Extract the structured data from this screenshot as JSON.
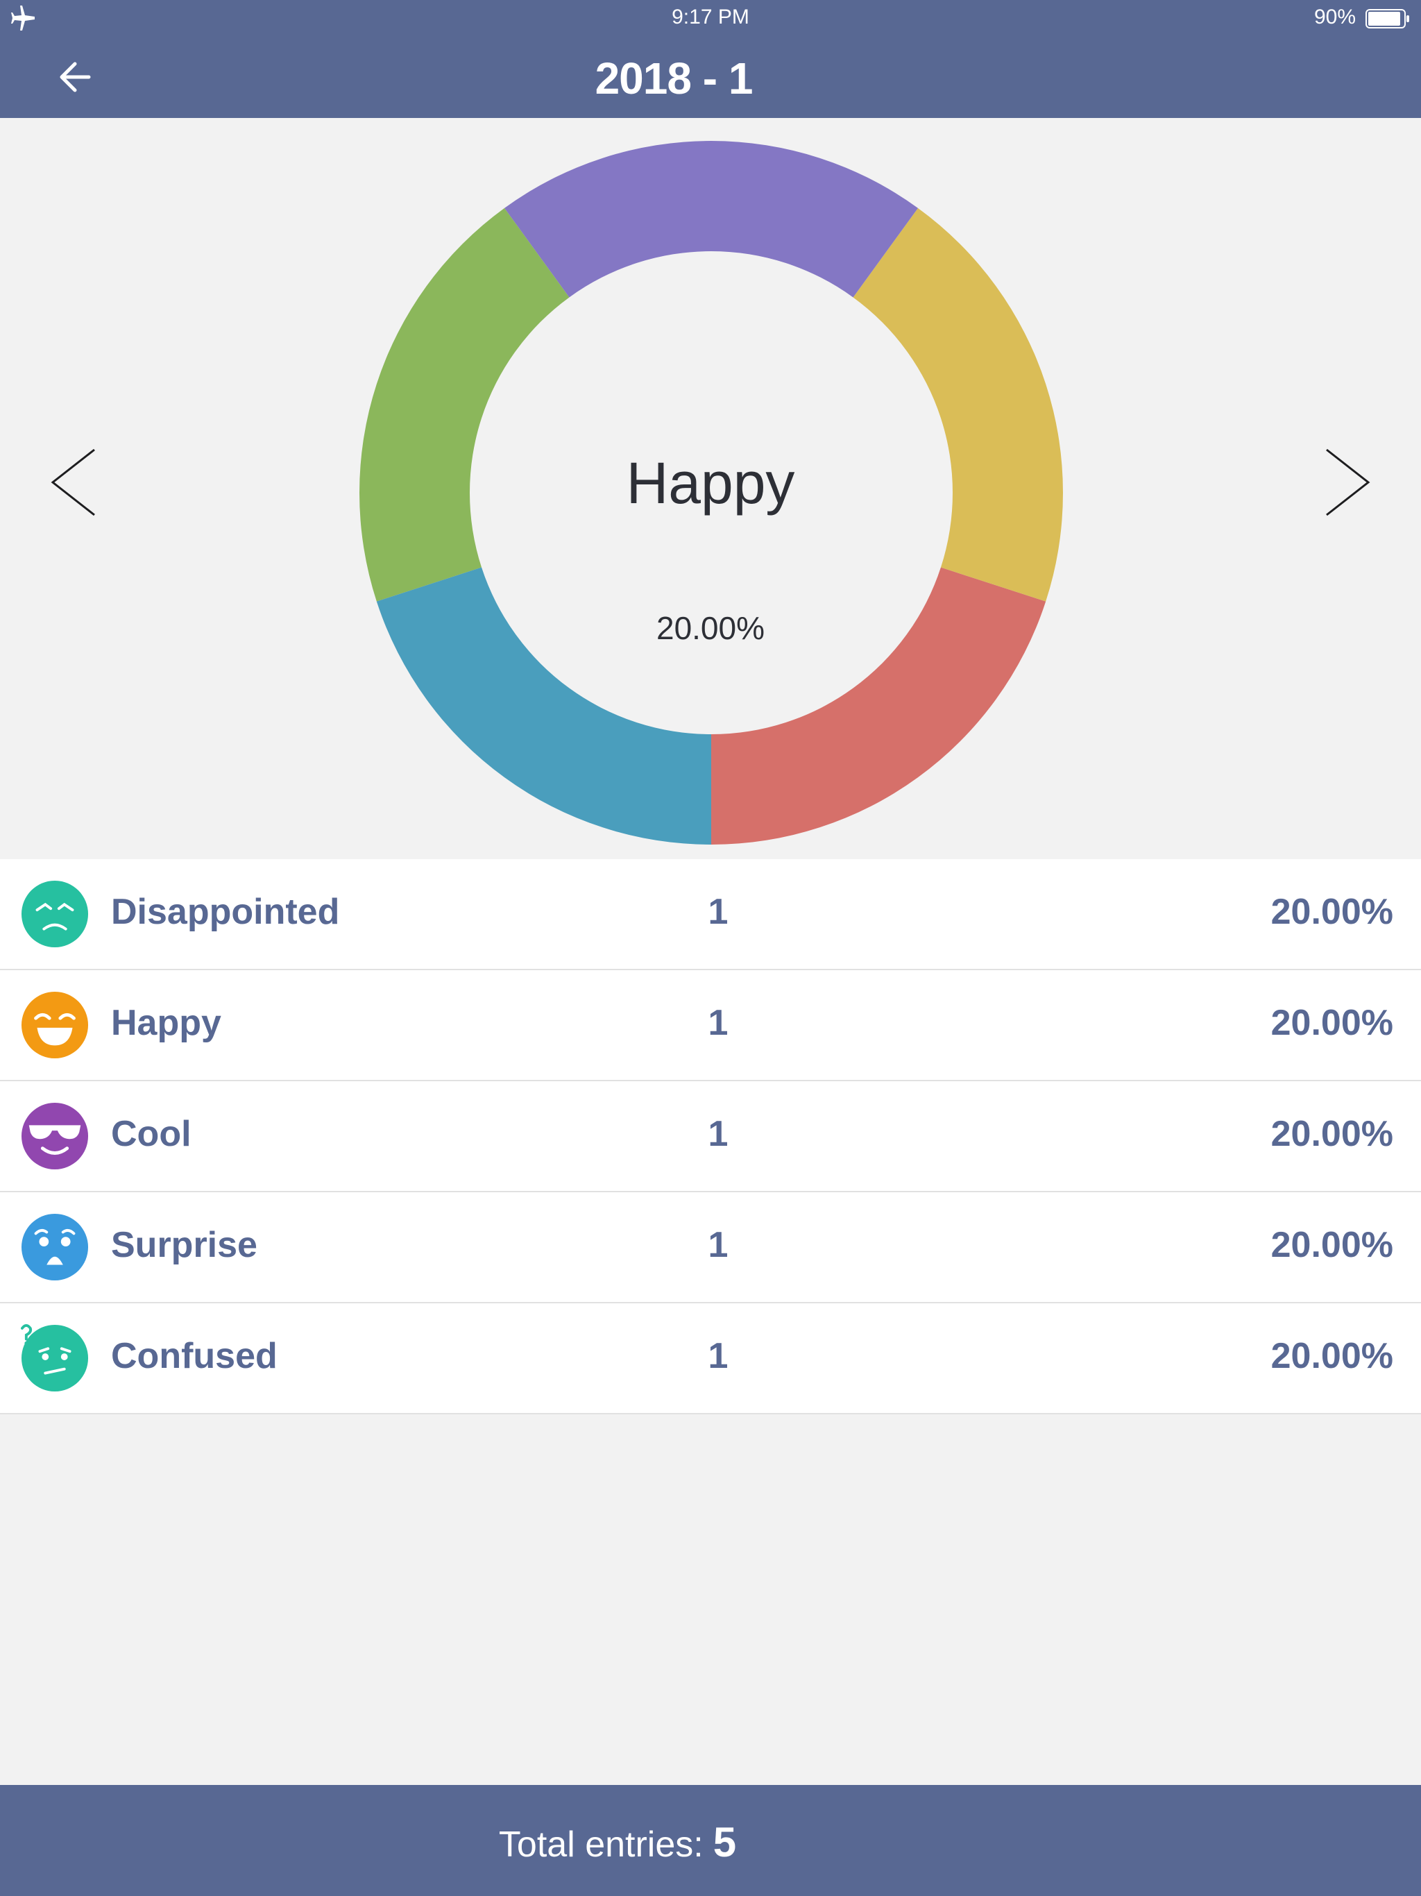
{
  "status_bar": {
    "time": "9:17 PM",
    "battery": "90%"
  },
  "nav": {
    "title": "2018 - 1"
  },
  "chart_data": {
    "type": "pie",
    "categories": [
      "Disappointed",
      "Happy",
      "Cool",
      "Surprise",
      "Confused"
    ],
    "values": [
      20,
      20,
      20,
      20,
      20
    ],
    "colors": [
      "#d6706a",
      "#dabd57",
      "#8477c4",
      "#8bb75b",
      "#4a9ebd"
    ],
    "title": "",
    "selected": "Happy"
  },
  "center": {
    "label": "Happy",
    "percent": "20.00%"
  },
  "rows": [
    {
      "name": "Disappointed",
      "count": "1",
      "percent": "20.00%",
      "icon": "disappointed-face-icon",
      "color": "#26c0a0"
    },
    {
      "name": "Happy",
      "count": "1",
      "percent": "20.00%",
      "icon": "happy-face-icon",
      "color": "#f39a13"
    },
    {
      "name": "Cool",
      "count": "1",
      "percent": "20.00%",
      "icon": "cool-face-icon",
      "color": "#9147af"
    },
    {
      "name": "Surprise",
      "count": "1",
      "percent": "20.00%",
      "icon": "surprise-face-icon",
      "color": "#3a9ade"
    },
    {
      "name": "Confused",
      "count": "1",
      "percent": "20.00%",
      "icon": "confused-face-icon",
      "color": "#26c0a0"
    }
  ],
  "footer": {
    "label": "Total entries:",
    "value": "5"
  }
}
